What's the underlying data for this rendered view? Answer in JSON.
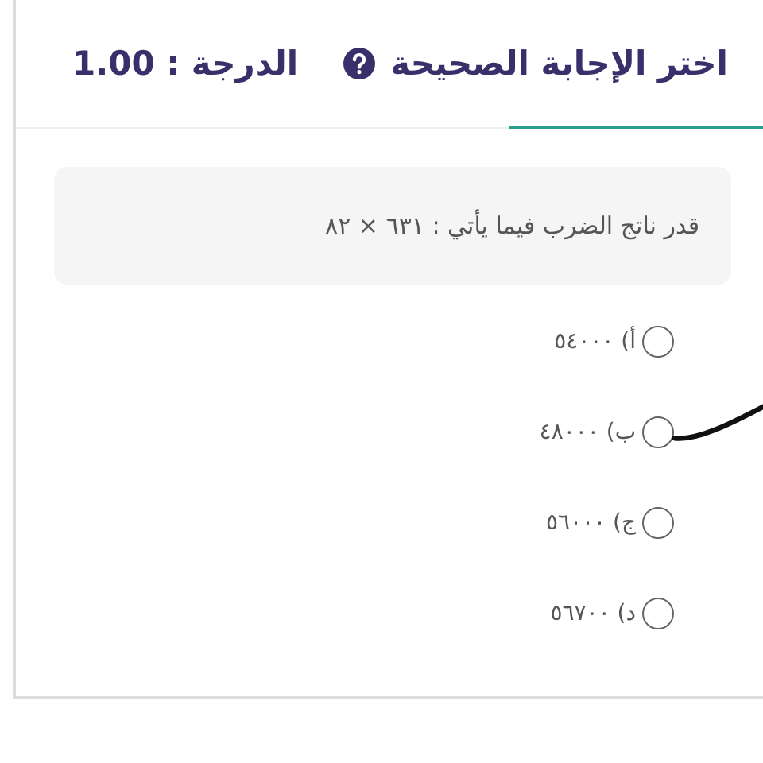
{
  "header": {
    "title": "اختر الإجابة الصحيحة",
    "grade": "الدرجة : 1.00"
  },
  "question": "قدر ناتج الضرب فيما يأتي : ٦٣١ × ٨٢",
  "options": [
    {
      "label": "أ) ٥٤٠٠٠",
      "selected": false,
      "marked": false
    },
    {
      "label": "ب) ٤٨٠٠٠",
      "selected": false,
      "marked": true
    },
    {
      "label": "ج) ٥٦٠٠٠",
      "selected": false,
      "marked": false
    },
    {
      "label": "د) ٥٦٧٠٠",
      "selected": false,
      "marked": false
    }
  ]
}
